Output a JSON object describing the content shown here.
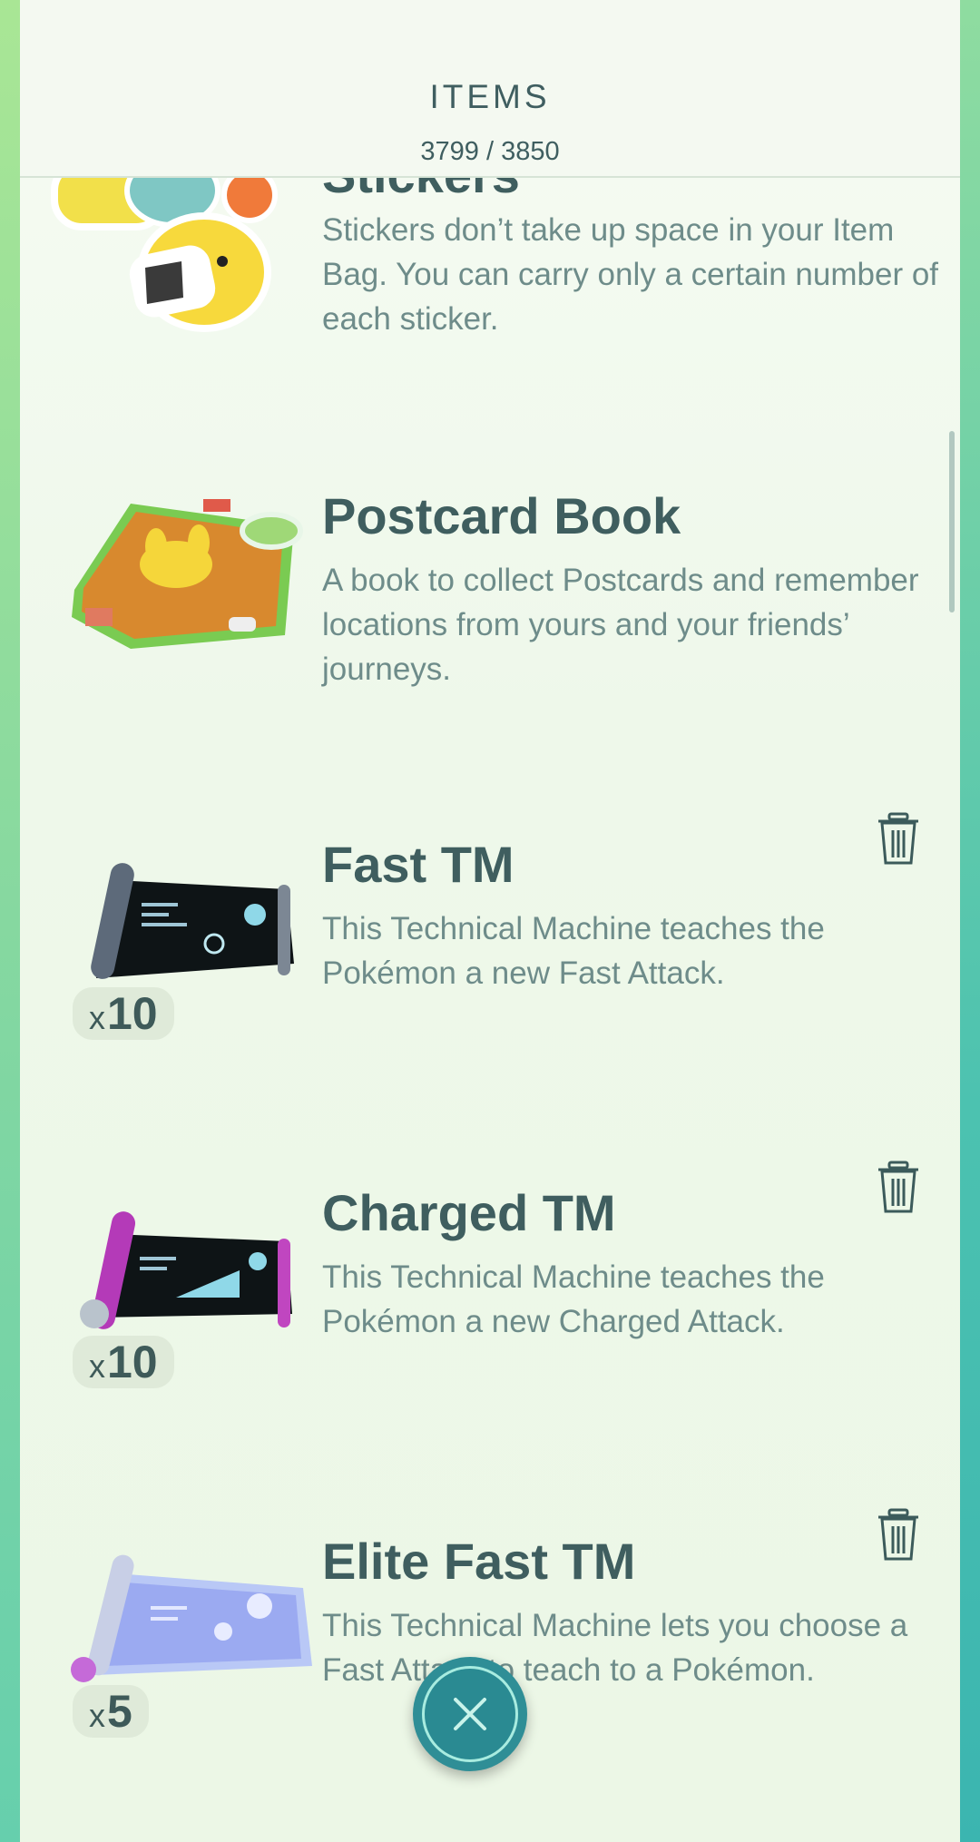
{
  "header": {
    "title": "ITEMS",
    "count": "3799 / 3850"
  },
  "items": [
    {
      "name": "Stickers",
      "description": "Stickers don’t take up space in your Item Bag. You can carry only a certain number of each sticker.",
      "icon": "stickers-image"
    },
    {
      "name": "Postcard Book",
      "description": "A book to collect Postcards and remember locations from yours and your friends’ journeys.",
      "icon": "postcard-book-image"
    },
    {
      "name": "Fast TM",
      "description": "This Technical Machine teaches the Pokémon a new Fast Attack.",
      "qty_prefix": "x",
      "qty": "10",
      "icon": "fast-tm-image"
    },
    {
      "name": "Charged TM",
      "description": "This Technical Machine teaches the Pokémon a new Charged Attack.",
      "qty_prefix": "x",
      "qty": "10",
      "icon": "charged-tm-image"
    },
    {
      "name": "Elite Fast TM",
      "description": "This Technical Machine lets you choose a Fast Attack to teach to a Pokémon.",
      "qty_prefix": "x",
      "qty": "5",
      "icon": "elite-fast-tm-image"
    }
  ],
  "icons": {
    "trash": "trash-icon",
    "close": "close-icon"
  },
  "colors": {
    "accent": "#2f8e96",
    "title_text": "#3f5e5f",
    "desc_text": "#6e8c8a"
  }
}
